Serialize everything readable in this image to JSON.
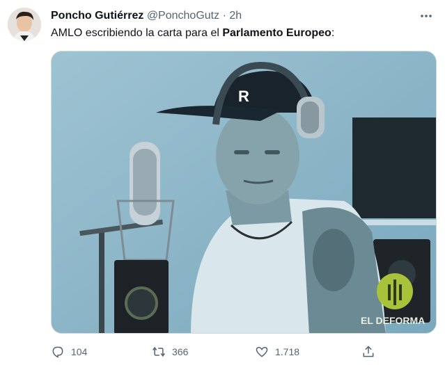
{
  "tweet": {
    "author_name": "Poncho Gutiérrez",
    "handle": "@PonchoGutz",
    "separator": "·",
    "time": "2h",
    "text_before": "AMLO escribiendo la carta para el ",
    "text_bold": "Parlamento Europeo",
    "text_after": ":"
  },
  "media": {
    "cap_logo": "R",
    "watermark": "EL DEFORMA"
  },
  "actions": {
    "replies": "104",
    "retweets": "366",
    "likes": "1.718"
  },
  "icons": {
    "more": "more-icon",
    "reply": "reply-icon",
    "retweet": "retweet-icon",
    "like": "like-icon",
    "share": "share-icon"
  },
  "colors": {
    "text": "#0f1419",
    "secondary": "#536471",
    "media_tint": "#8fb7c9"
  }
}
